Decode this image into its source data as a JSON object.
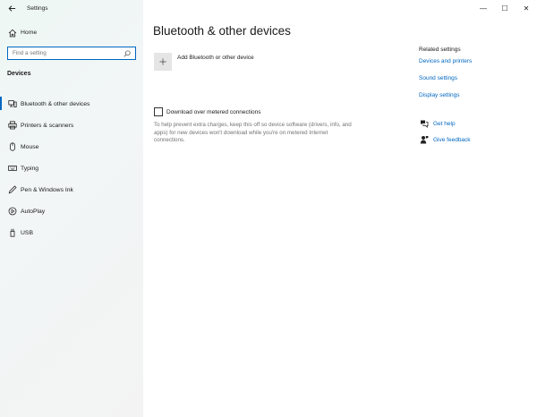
{
  "window": {
    "title": "Settings",
    "minimize_glyph": "—",
    "maximize_glyph": "☐",
    "close_glyph": "✕"
  },
  "sidebar": {
    "home_label": "Home",
    "search_placeholder": "Find a setting",
    "section_title": "Devices",
    "items": [
      {
        "label": "Bluetooth & other devices",
        "icon": "bluetooth-devices-icon",
        "active": true
      },
      {
        "label": "Printers & scanners",
        "icon": "printer-icon",
        "active": false
      },
      {
        "label": "Mouse",
        "icon": "mouse-icon",
        "active": false
      },
      {
        "label": "Typing",
        "icon": "keyboard-icon",
        "active": false
      },
      {
        "label": "Pen & Windows Ink",
        "icon": "pen-icon",
        "active": false
      },
      {
        "label": "AutoPlay",
        "icon": "autoplay-icon",
        "active": false
      },
      {
        "label": "USB",
        "icon": "usb-icon",
        "active": false
      }
    ]
  },
  "main": {
    "page_title": "Bluetooth & other devices",
    "add_device_label": "Add Bluetooth or other device",
    "metered_label": "Download over metered connections",
    "metered_desc": "To help prevent extra charges, keep this off so device software (drivers, info, and apps) for new devices won't download while you're on metered Internet connections.",
    "metered_checked": false
  },
  "related": {
    "title": "Related settings",
    "links": [
      "Devices and printers",
      "Sound settings",
      "Display settings"
    ],
    "get_help": "Get help",
    "give_feedback": "Give feedback"
  },
  "colors": {
    "accent": "#0067c0",
    "sidebar_bg": "#f2f6f6",
    "muted_text": "#737373"
  }
}
